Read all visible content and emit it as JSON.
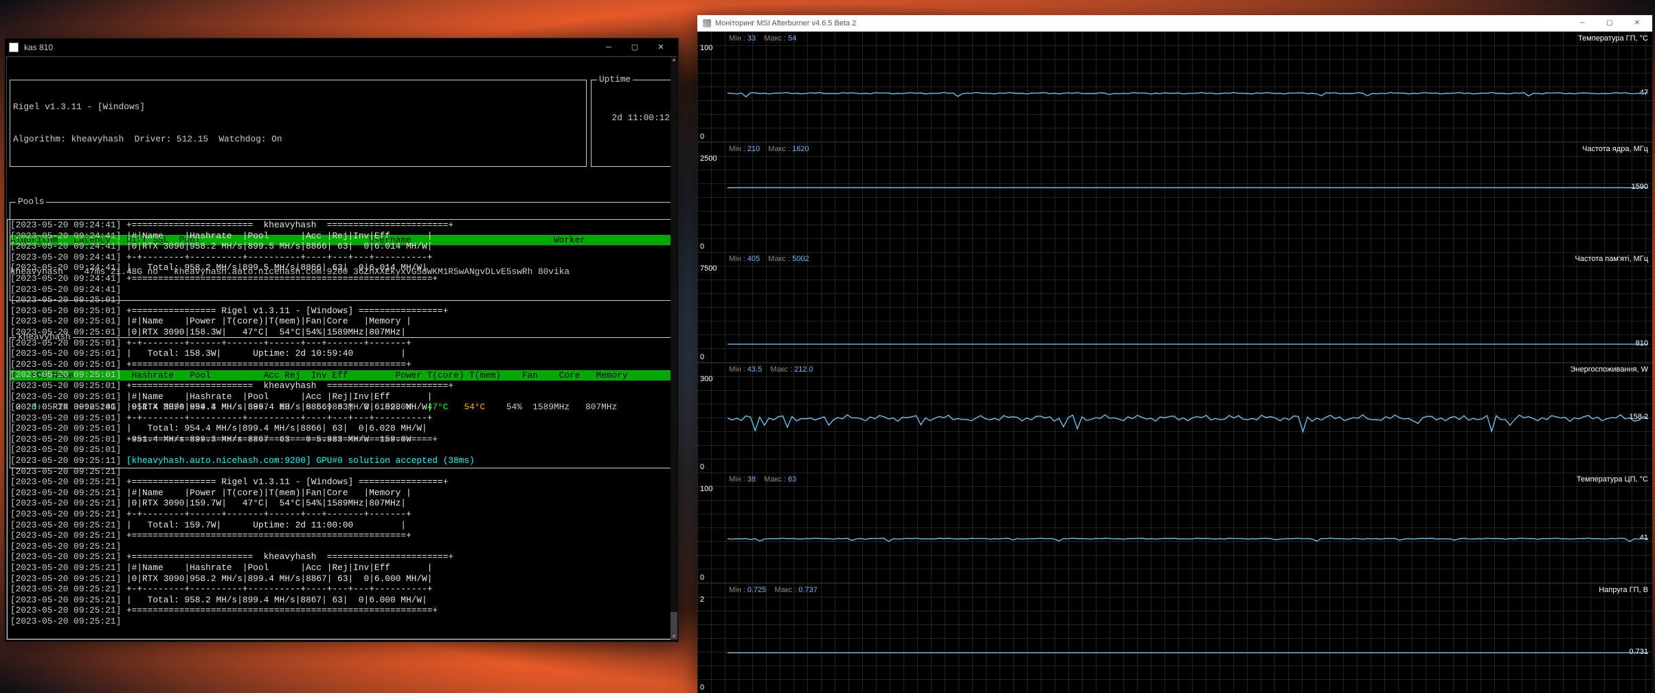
{
  "console": {
    "title": "kas 810",
    "header_line": "Rigel v1.3.11 - [Windows]",
    "algo_line": "Algorithm: kheavyhash  Driver: 512.15  Watchdog: On",
    "uptime_label": "Uptime",
    "uptime_value": "2d 11:00:12",
    "pools_label": "Pools",
    "pools_header": "Algorithm   Latency   Diff SSL  Pool                                Username                           Worker",
    "pools_row": "kheavyhash    47ms 21.48G no   kheavyhash.auto.nicehash.com:9200 36ZnXXEkyxvG5dWKM1R5wANgvDLvE5swRh 80vika",
    "gpu_label": "kheavyhash",
    "gpu_header": "#   PCI Name           Hashrate   Pool          Acc Rej  Inv Eff         Power T(core) T(mem)    Fan    Core   Memory",
    "gpu_row1": " 0 2d:0 RTX 3090 24G   951.4 MH/s 899.3 MH/s 8867  63   0 5.983 MH/W  159.0W   47°C   54°C    54%  1589MHz   807MHz",
    "gpu_row2": "                       951.4 MH/s 899.3 MH/s 8867  63   0 5.983 MH/W  159.0W",
    "log": [
      "[2023-05-20 09:24:41] +=======================  kheavyhash  =======================+",
      "[2023-05-20 09:24:41] |#|Name    |Hashrate  |Pool      |Acc |Rej|Inv|Eff       |",
      "[2023-05-20 09:24:41] |0|RTX 3090|958.2 MH/s|899.5 MH/s|8866| 63|  0|6.014 MH/W|",
      "[2023-05-20 09:24:41] +-+--------+----------+----------+----+---+---+----------+",
      "[2023-05-20 09:24:41] |   Total: 958.2 MH/s|899.5 MH/s|8866| 63|  0|6.014 MH/W|",
      "[2023-05-20 09:24:41] +=========================================================+",
      "[2023-05-20 09:24:41] ",
      "[2023-05-20 09:25:01] ",
      "[2023-05-20 09:25:01] +================ Rigel v1.3.11 - [Windows] ================+",
      "[2023-05-20 09:25:01] |#|Name    |Power |T(core)|T(mem)|Fan|Core   |Memory |",
      "[2023-05-20 09:25:01] |0|RTX 3090|158.3W|   47°C|  54°C|54%|1589MHz|807MHz|",
      "[2023-05-20 09:25:01] +-+--------+------+-------+------+---+-------+-------+",
      "[2023-05-20 09:25:01] |   Total: 158.3W|      Uptime: 2d 10:59:40         |",
      "[2023-05-20 09:25:01] +====================================================+",
      "[2023-05-20 09:25:01] ",
      "[2023-05-20 09:25:01] +=======================  kheavyhash  =======================+",
      "[2023-05-20 09:25:01] |#|Name    |Hashrate  |Pool      |Acc |Rej|Inv|Eff       |",
      "[2023-05-20 09:25:01] |0|RTX 3090|954.4 MH/s|899.4 MH/s|8866| 63|  0|6.028 MH/W|",
      "[2023-05-20 09:25:01] +-+--------+----------+----------+----+---+---+----------+",
      "[2023-05-20 09:25:01] |   Total: 954.4 MH/s|899.4 MH/s|8866| 63|  0|6.028 MH/W|",
      "[2023-05-20 09:25:01] +=========================================================+",
      "[2023-05-20 09:25:01] ",
      "[2023-05-20 09:25:11] [kheavyhash.auto.nicehash.com:9200] GPU#0 solution accepted (38ms)",
      "[2023-05-20 09:25:21] ",
      "[2023-05-20 09:25:21] +================ Rigel v1.3.11 - [Windows] ================+",
      "[2023-05-20 09:25:21] |#|Name    |Power |T(core)|T(mem)|Fan|Core   |Memory |",
      "[2023-05-20 09:25:21] |0|RTX 3090|159.7W|   47°C|  54°C|54%|1589MHz|807MHz|",
      "[2023-05-20 09:25:21] +-+--------+------+-------+------+---+-------+-------+",
      "[2023-05-20 09:25:21] |   Total: 159.7W|      Uptime: 2d 11:00:00         |",
      "[2023-05-20 09:25:21] +====================================================+",
      "[2023-05-20 09:25:21] ",
      "[2023-05-20 09:25:21] +=======================  kheavyhash  =======================+",
      "[2023-05-20 09:25:21] |#|Name    |Hashrate  |Pool      |Acc |Rej|Inv|Eff       |",
      "[2023-05-20 09:25:21] |0|RTX 3090|958.2 MH/s|899.4 MH/s|8867| 63|  0|6.000 MH/W|",
      "[2023-05-20 09:25:21] +-+--------+----------+----------+----+---+---+----------+",
      "[2023-05-20 09:25:21] |   Total: 958.2 MH/s|899.4 MH/s|8867| 63|  0|6.000 MH/W|",
      "[2023-05-20 09:25:21] +=========================================================+",
      "[2023-05-20 09:25:21] "
    ]
  },
  "afterburner": {
    "title": "Моніторинг MSI Afterburner v4.6.5 Beta 2",
    "min_label": "Мін",
    "max_label": "Макс",
    "charts": [
      {
        "title": "Температура ГП, °С",
        "min": "33",
        "max": "54",
        "y_top": "100",
        "y_bot": "0",
        "current": "47",
        "line_y": 0.55,
        "noise": 3
      },
      {
        "title": "Частота ядра, МГц",
        "min": "210",
        "max": "1620",
        "y_top": "2500",
        "y_bot": "0",
        "current": "1590",
        "line_y": 0.37,
        "noise": 0
      },
      {
        "title": "Частота пам'яті, МГц",
        "min": "405",
        "max": "5002",
        "y_top": "7500",
        "y_bot": "0",
        "current": "810",
        "line_y": 0.89,
        "noise": 0
      },
      {
        "title": "Энергоспоживання, W",
        "min": "43.5",
        "max": "212.0",
        "y_top": "300",
        "y_bot": "0",
        "current": "158.2",
        "line_y": 0.48,
        "noise": 12
      },
      {
        "title": "Температура ЦП, °С",
        "min": "38",
        "max": "63",
        "y_top": "100",
        "y_bot": "0",
        "current": "41",
        "line_y": 0.6,
        "noise": 2
      },
      {
        "title": "Напруга ГП, В",
        "min": "0.725",
        "max": "0.737",
        "y_top": "2",
        "y_bot": "0",
        "current": "0.731",
        "line_y": 0.64,
        "noise": 0
      }
    ]
  },
  "chart_data": [
    {
      "type": "line",
      "title": "Температура ГП, °С",
      "ylim": [
        0,
        100
      ],
      "min": 33,
      "max": 54,
      "current": 47,
      "xlabel": "",
      "ylabel": ""
    },
    {
      "type": "line",
      "title": "Частота ядра, МГц",
      "ylim": [
        0,
        2500
      ],
      "min": 210,
      "max": 1620,
      "current": 1590,
      "xlabel": "",
      "ylabel": ""
    },
    {
      "type": "line",
      "title": "Частота пам'яті, МГц",
      "ylim": [
        0,
        7500
      ],
      "min": 405,
      "max": 5002,
      "current": 810,
      "xlabel": "",
      "ylabel": ""
    },
    {
      "type": "line",
      "title": "Энергоспоживання, W",
      "ylim": [
        0,
        300
      ],
      "min": 43.5,
      "max": 212.0,
      "current": 158.2,
      "xlabel": "",
      "ylabel": ""
    },
    {
      "type": "line",
      "title": "Температура ЦП, °С",
      "ylim": [
        0,
        100
      ],
      "min": 38,
      "max": 63,
      "current": 41,
      "xlabel": "",
      "ylabel": ""
    },
    {
      "type": "line",
      "title": "Напруга ГП, В",
      "ylim": [
        0,
        2
      ],
      "min": 0.725,
      "max": 0.737,
      "current": 0.731,
      "xlabel": "",
      "ylabel": ""
    }
  ]
}
